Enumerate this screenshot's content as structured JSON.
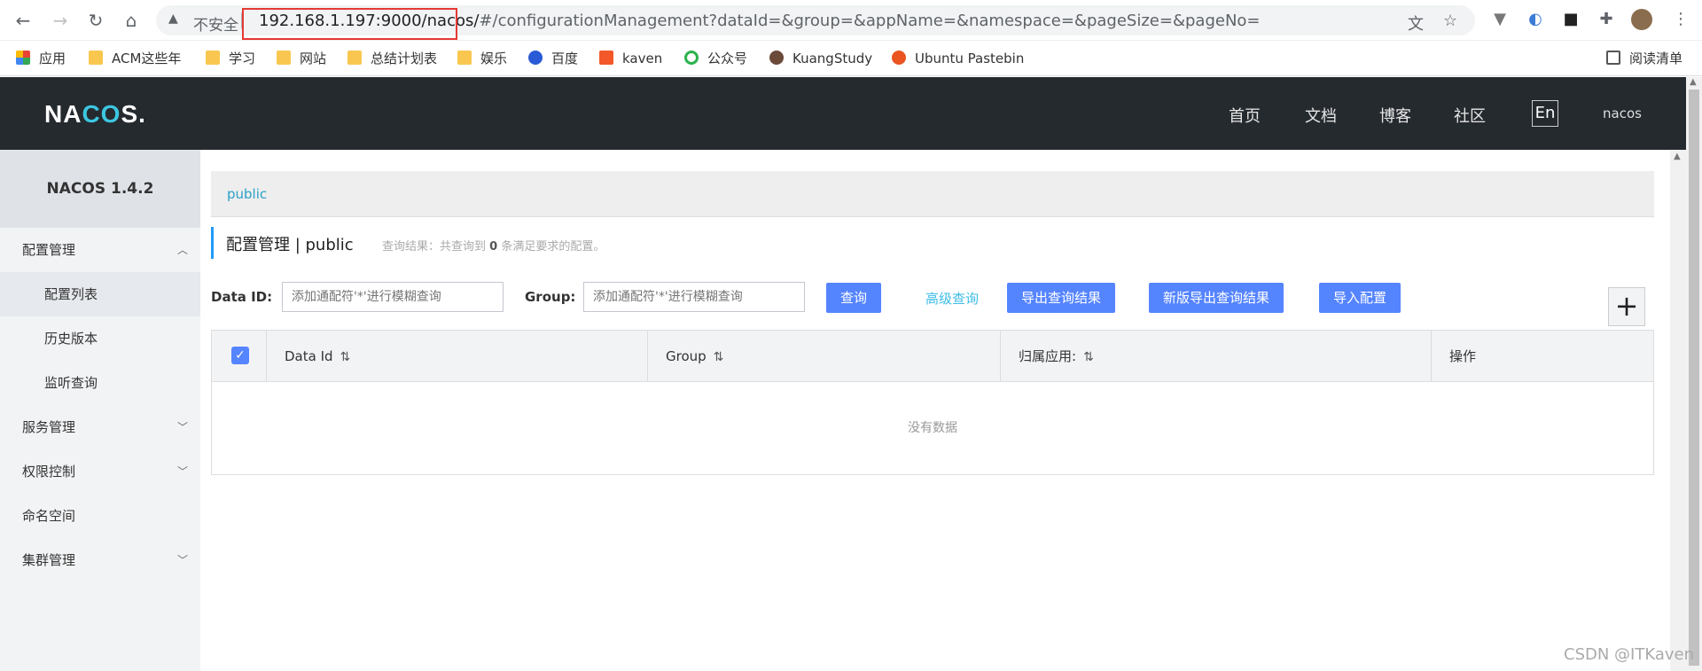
{
  "browser": {
    "insecure_label": "不安全",
    "url_host": "192.168.1.197:9000/nacos/",
    "url_rest": "#/configurationManagement?dataId=&group=&appName=&namespace=&pageSize=&pageNo="
  },
  "bookmarks": [
    {
      "label": "应用"
    },
    {
      "label": "ACM这些年"
    },
    {
      "label": "学习"
    },
    {
      "label": "网站"
    },
    {
      "label": "总结计划表"
    },
    {
      "label": "娱乐"
    },
    {
      "label": "百度"
    },
    {
      "label": "kaven"
    },
    {
      "label": "公众号"
    },
    {
      "label": "KuangStudy"
    },
    {
      "label": "Ubuntu Pastebin"
    }
  ],
  "reading_list": "阅读清单",
  "header": {
    "logo_a": "NA",
    "logo_co": "CO",
    "logo_b": "S.",
    "nav": [
      "首页",
      "文档",
      "博客",
      "社区"
    ],
    "lang": "En",
    "user": "nacos"
  },
  "sidebar": {
    "brand": "NACOS 1.4.2",
    "menu": [
      {
        "label": "配置管理"
      },
      {
        "label": "配置列表"
      },
      {
        "label": "历史版本"
      },
      {
        "label": "监听查询"
      },
      {
        "label": "服务管理"
      },
      {
        "label": "权限控制"
      },
      {
        "label": "命名空间"
      },
      {
        "label": "集群管理"
      }
    ]
  },
  "main": {
    "namespace_tab": "public",
    "title": "配置管理  |  public",
    "query_prefix": "查询结果：共查询到 ",
    "query_count": "0",
    "query_suffix": " 条满足要求的配置。",
    "filters": {
      "dataid_label": "Data ID:",
      "dataid_placeholder": "添加通配符'*'进行模糊查询",
      "group_label": "Group:",
      "group_placeholder": "添加通配符'*'进行模糊查询"
    },
    "buttons": {
      "query": "查询",
      "advanced": "高级查询",
      "export": "导出查询结果",
      "export_new": "新版导出查询结果",
      "import": "导入配置",
      "add": "+"
    },
    "table": {
      "columns": [
        "Data Id",
        "Group",
        "归属应用:",
        "操作"
      ],
      "empty": "没有数据"
    }
  },
  "watermark": "CSDN @ITKaven"
}
